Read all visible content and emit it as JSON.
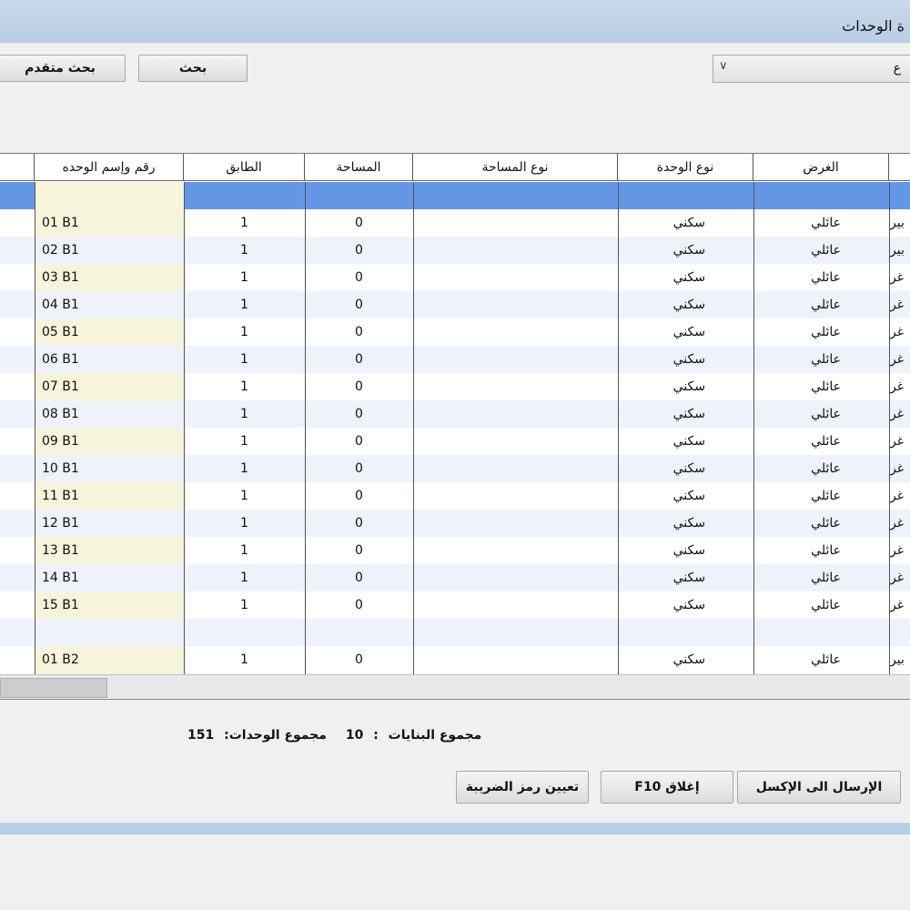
{
  "window": {
    "title": "ة الوحدات"
  },
  "toolbar": {
    "search_label": "بحث",
    "advanced_search_label": "بحث متقدم",
    "combo_value": "ع"
  },
  "grid": {
    "columns": {
      "partial": "",
      "purpose": "الغرض",
      "unit_type": "نوع الوحدة",
      "area_type": "نوع المساحة",
      "area": "المساحة",
      "floor": "الطابق",
      "unit_name": "رقم وإسم الوحده"
    },
    "rows": [
      {
        "partial": "بير",
        "purpose": "عائلي",
        "unit_type": "سكني",
        "area_type": "",
        "area": "0",
        "floor": "1",
        "unit_name": "01 B1"
      },
      {
        "partial": "بير",
        "purpose": "عائلي",
        "unit_type": "سكني",
        "area_type": "",
        "area": "0",
        "floor": "1",
        "unit_name": "02 B1"
      },
      {
        "partial": "غر",
        "purpose": "عائلي",
        "unit_type": "سكني",
        "area_type": "",
        "area": "0",
        "floor": "1",
        "unit_name": "03 B1"
      },
      {
        "partial": "غر",
        "purpose": "عائلي",
        "unit_type": "سكني",
        "area_type": "",
        "area": "0",
        "floor": "1",
        "unit_name": "04 B1"
      },
      {
        "partial": "غر",
        "purpose": "عائلي",
        "unit_type": "سكني",
        "area_type": "",
        "area": "0",
        "floor": "1",
        "unit_name": "05 B1"
      },
      {
        "partial": "غر",
        "purpose": "عائلي",
        "unit_type": "سكني",
        "area_type": "",
        "area": "0",
        "floor": "1",
        "unit_name": "06 B1"
      },
      {
        "partial": "غر",
        "purpose": "عائلي",
        "unit_type": "سكني",
        "area_type": "",
        "area": "0",
        "floor": "1",
        "unit_name": "07 B1"
      },
      {
        "partial": "غر",
        "purpose": "عائلي",
        "unit_type": "سكني",
        "area_type": "",
        "area": "0",
        "floor": "1",
        "unit_name": "08 B1"
      },
      {
        "partial": "غر",
        "purpose": "عائلي",
        "unit_type": "سكني",
        "area_type": "",
        "area": "0",
        "floor": "1",
        "unit_name": "09 B1"
      },
      {
        "partial": "غر",
        "purpose": "عائلي",
        "unit_type": "سكني",
        "area_type": "",
        "area": "0",
        "floor": "1",
        "unit_name": "10 B1"
      },
      {
        "partial": "غر",
        "purpose": "عائلي",
        "unit_type": "سكني",
        "area_type": "",
        "area": "0",
        "floor": "1",
        "unit_name": "11 B1"
      },
      {
        "partial": "غر",
        "purpose": "عائلي",
        "unit_type": "سكني",
        "area_type": "",
        "area": "0",
        "floor": "1",
        "unit_name": "12 B1"
      },
      {
        "partial": "غر",
        "purpose": "عائلي",
        "unit_type": "سكني",
        "area_type": "",
        "area": "0",
        "floor": "1",
        "unit_name": "13 B1"
      },
      {
        "partial": "غر",
        "purpose": "عائلي",
        "unit_type": "سكني",
        "area_type": "",
        "area": "0",
        "floor": "1",
        "unit_name": "14 B1"
      },
      {
        "partial": "غر",
        "purpose": "عائلي",
        "unit_type": "سكني",
        "area_type": "",
        "area": "0",
        "floor": "1",
        "unit_name": "15 B1"
      },
      {
        "partial": "",
        "purpose": "",
        "unit_type": "",
        "area_type": "",
        "area": "",
        "floor": "",
        "unit_name": ""
      },
      {
        "partial": "بير",
        "purpose": "عائلي",
        "unit_type": "سكني",
        "area_type": "",
        "area": "0",
        "floor": "1",
        "unit_name": "01 B2"
      }
    ]
  },
  "totals": {
    "buildings_label": "مجموع البنايات",
    "buildings_sep": ":",
    "buildings_value": "10",
    "units_label": "مجموع الوحدات:",
    "units_value": "151"
  },
  "actions": {
    "excel_label": "الإرسال الى الإكسل",
    "close_label": "إغلاق F10",
    "tax_label": "تعيين رمز الضريبة"
  }
}
